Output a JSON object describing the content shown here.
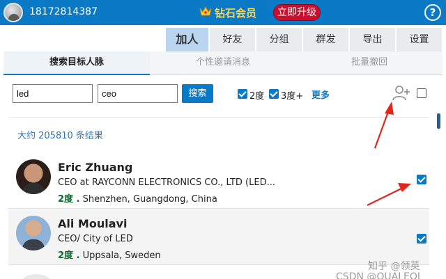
{
  "header": {
    "phone": "18172814387",
    "vip_label": "钻石会员",
    "upgrade_label": "立即升级",
    "help_label": "?",
    "accent_color": "#0a79c6",
    "upgrade_color": "#c8102e"
  },
  "main_tabs": [
    {
      "label": "加人",
      "active": true
    },
    {
      "label": "好友",
      "active": false
    },
    {
      "label": "分组",
      "active": false
    },
    {
      "label": "群发",
      "active": false
    },
    {
      "label": "导出",
      "active": false
    },
    {
      "label": "设置",
      "active": false
    }
  ],
  "sub_tabs": [
    {
      "label": "搜索目标人脉",
      "active": true
    },
    {
      "label": "个性邀请消息",
      "active": false
    },
    {
      "label": "批量撤回",
      "active": false
    }
  ],
  "search": {
    "keyword_value": "led",
    "title_value": "ceo",
    "search_label": "搜索",
    "degree2_label": "2度",
    "degree2_checked": true,
    "degree3_label": "3度+",
    "degree3_checked": true,
    "more_label": "更多",
    "select_all_checked": false
  },
  "results": {
    "count_text": "大约 205810 条结果",
    "items": [
      {
        "name": "Eric Zhuang",
        "title": "CEO at RAYCONN ELECTRONICS CO., LTD (LED...",
        "degree": "2度 .",
        "location": "Shenzhen, Guangdong, China",
        "checked": true
      },
      {
        "name": "Ali Moulavi",
        "title": "CEO/ City of LED",
        "degree": "2度 .",
        "location": "Uppsala, Sweden",
        "checked": true
      }
    ]
  },
  "watermark": "知乎 @领英\nCSDN @QUALEOI"
}
